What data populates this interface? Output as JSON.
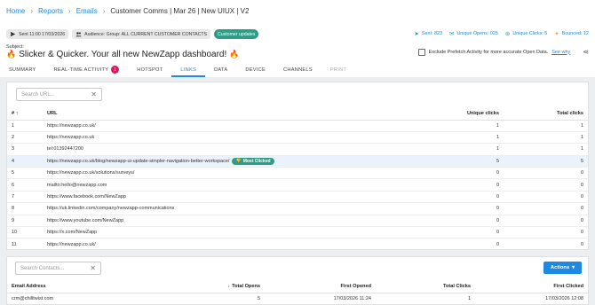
{
  "breadcrumb": {
    "items": [
      "Home",
      "Reports",
      "Emails"
    ],
    "current": "Customer Comms | Mar 26 | New UIUX | V2"
  },
  "meta": {
    "sent": "Sent 11:00 17/03/2026",
    "audience": "Audience: Group: ALL CURRENT CUSTOMER CONTACTS",
    "tag": "Customer updates"
  },
  "stats": {
    "sent": "Sent: 823",
    "opens": "Unique Opens: 025",
    "clicks": "Unique Clicks: 5",
    "bounced": "Bounced: 12"
  },
  "subject": {
    "label": "Subject:",
    "text": "Slicker & Quicker. Your all new NewZapp dashboard!"
  },
  "prefetch": {
    "label": "Exclude Prefetch Activity for more accurate Open Data.",
    "link": "See why"
  },
  "tabs": [
    {
      "label": "SUMMARY",
      "state": "normal"
    },
    {
      "label": "REAL-TIME ACTIVITY",
      "state": "normal",
      "count": "1"
    },
    {
      "label": "HOTSPOT",
      "state": "normal"
    },
    {
      "label": "LINKS",
      "state": "active"
    },
    {
      "label": "DATA",
      "state": "normal"
    },
    {
      "label": "DEVICE",
      "state": "normal"
    },
    {
      "label": "CHANNELS",
      "state": "normal"
    },
    {
      "label": "PRINT",
      "state": "disabled"
    }
  ],
  "links_panel": {
    "search_placeholder": "Search URL...",
    "columns": {
      "num": "#",
      "url": "URL",
      "unique": "Unique clicks",
      "total": "Total clicks"
    },
    "most_clicked_label": "Most Clicked",
    "rows": [
      {
        "num": "1",
        "url": "https://newzapp.co.uk/",
        "unique": "1",
        "total": "1"
      },
      {
        "num": "2",
        "url": "https://newzapp.co.uk",
        "unique": "1",
        "total": "1"
      },
      {
        "num": "3",
        "url": "tel:01392447200",
        "unique": "1",
        "total": "1"
      },
      {
        "num": "4",
        "url": "https://newzapp.co.uk/blog/newzapp-ui-update-simpler-navigation-better-workspace/",
        "unique": "5",
        "total": "5",
        "highlight": true
      },
      {
        "num": "5",
        "url": "https://newzapp.co.uk/solutions/surveys/",
        "unique": "0",
        "total": "0"
      },
      {
        "num": "6",
        "url": "mailto:hello@newzapp.com",
        "unique": "0",
        "total": "0"
      },
      {
        "num": "7",
        "url": "https://www.facebook.com/NewZapp",
        "unique": "0",
        "total": "0"
      },
      {
        "num": "8",
        "url": "https://uk.linkedin.com/company/newzapp-communications",
        "unique": "0",
        "total": "0"
      },
      {
        "num": "9",
        "url": "https://www.youtube.com/NewZapp",
        "unique": "0",
        "total": "0"
      },
      {
        "num": "10",
        "url": "https://x.com/NewZapp",
        "unique": "0",
        "total": "0"
      },
      {
        "num": "11",
        "url": "https://newzapp.co.uk/",
        "unique": "0",
        "total": "0"
      }
    ]
  },
  "contacts_panel": {
    "search_placeholder": "Search Contacts...",
    "actions_label": "Actions",
    "columns": {
      "email": "Email Address",
      "opens": "Total Opens",
      "first_opened": "First Opened",
      "clicks": "Total Clicks",
      "first_clicked": "First Clicked"
    },
    "rows": [
      {
        "email": "crm@chilltwist.com",
        "opens": "5",
        "first_opened": "17/03/2026 11:24",
        "clicks": "1",
        "first_clicked": "17/03/2026 12:08"
      }
    ]
  },
  "colors": {
    "accent": "#1e88e5",
    "success": "#2e9d87",
    "badge": "#d81b60"
  }
}
